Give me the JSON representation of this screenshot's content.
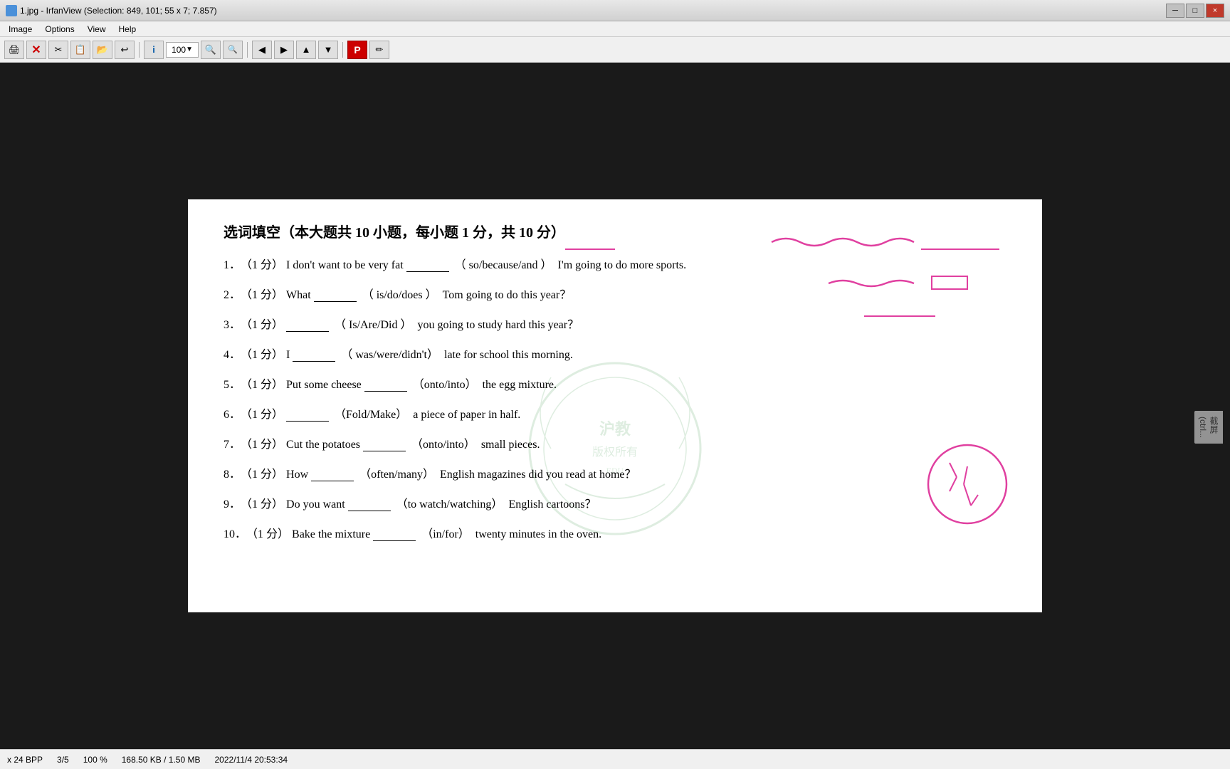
{
  "titlebar": {
    "title": "1.jpg - IrfanView (Selection: 849, 101; 55 x 7; 7.857)",
    "close_btn": "×"
  },
  "menubar": {
    "items": [
      "Image",
      "Options",
      "View",
      "Help"
    ]
  },
  "toolbar": {
    "zoom_value": "100",
    "zoom_dropdown": "▼",
    "p_label": "P"
  },
  "document": {
    "title": "选词填空（本大题共 10 小题，每小题 1 分，共 10 分）",
    "questions": [
      {
        "num": "1．",
        "points": "（1 分）",
        "before": "I don't want to be very fat",
        "blank": "",
        "choices": "（ so/because/and ）",
        "after": "I'm going to do more sports."
      },
      {
        "num": "2．",
        "points": "（1 分）",
        "before": "What",
        "blank": "",
        "choices": "（ is/do/does ）",
        "after": "Tom going to do this year？"
      },
      {
        "num": "3．",
        "points": "（1 分）",
        "before": "",
        "blank": "",
        "choices": "（ Is/Are/Did ）",
        "after": "you going to study hard this year？"
      },
      {
        "num": "4．",
        "points": "（1 分）",
        "before": "I",
        "blank": "",
        "choices": "（ was/were/didn't）",
        "after": "late for school this morning."
      },
      {
        "num": "5．",
        "points": "（1 分）",
        "before": "Put some cheese",
        "blank": "",
        "choices": "（onto/into）",
        "after": "the egg mixture."
      },
      {
        "num": "6．",
        "points": "（1 分）",
        "before": "",
        "blank": "",
        "choices": "（Fold/Make）",
        "after": "a piece of paper in half."
      },
      {
        "num": "7．",
        "points": "（1 分）",
        "before": "Cut the potatoes",
        "blank": "",
        "choices": "（onto/into）",
        "after": "small pieces."
      },
      {
        "num": "8．",
        "points": "（1 分）",
        "before": "How",
        "blank": "",
        "choices": "（often/many）",
        "after": "English magazines did you read at home？"
      },
      {
        "num": "9．",
        "points": "（1 分）",
        "before": "Do you want",
        "blank": "",
        "choices": "（to watch/watching）",
        "after": "English cartoons？"
      },
      {
        "num": "10．",
        "points": "（1 分）",
        "before": "Bake the mixture",
        "blank": "",
        "choices": "（in/for）",
        "after": "twenty minutes in the oven."
      }
    ]
  },
  "statusbar": {
    "bpp": "x 24 BPP",
    "position": "3/5",
    "zoom": "100 %",
    "filesize": "168.50 KB / 1.50 MB",
    "datetime": "2022/11/4 20:53:34"
  },
  "side_panel": {
    "label": "截屏",
    "shortcut": "(ctrl..."
  }
}
